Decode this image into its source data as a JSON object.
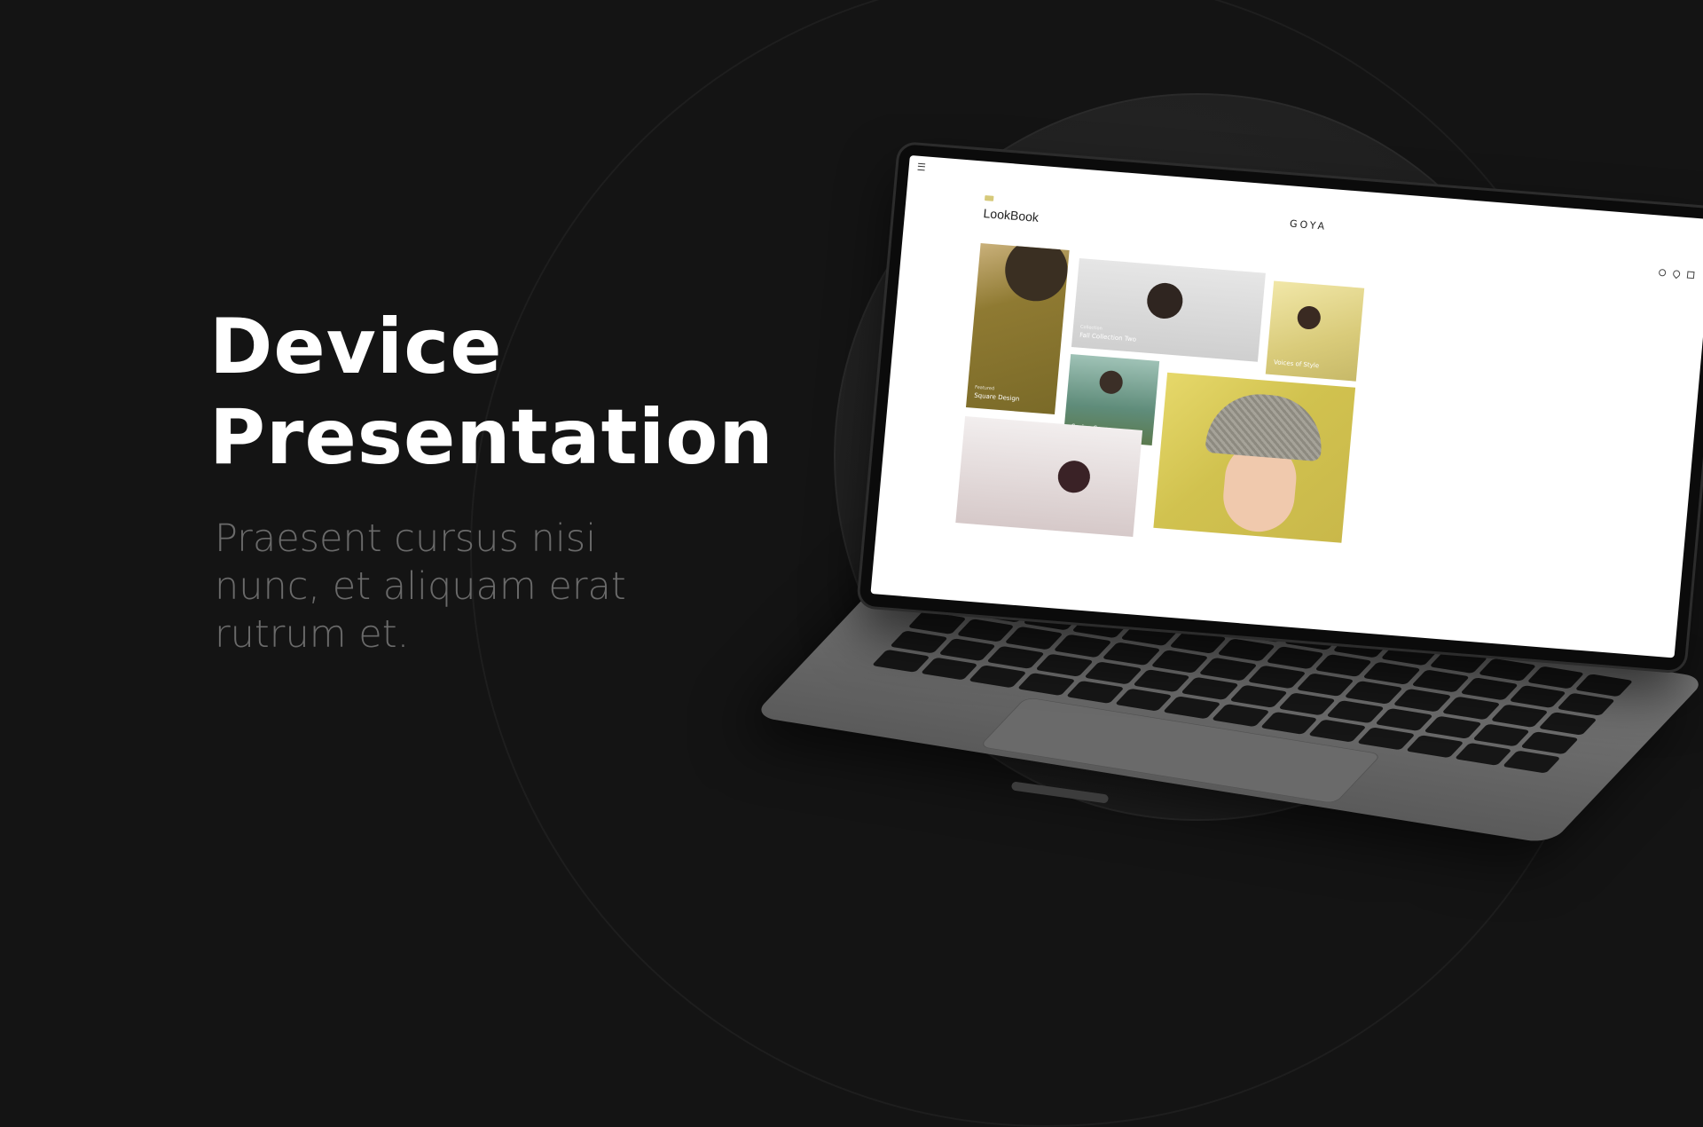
{
  "headline": {
    "line1": "Device",
    "line2": "Presentation"
  },
  "subtext": {
    "line1": "Praesent cursus nisi",
    "line2": "nunc, et aliquam erat",
    "line3": "rutrum et."
  },
  "mock_site": {
    "brand": "GOYA",
    "page_title": "LookBook",
    "tiles": [
      {
        "title": "Square Design",
        "tag": "Featured"
      },
      {
        "title": "Fall Collection Two",
        "tag": "Collection"
      },
      {
        "title": "Voices of Style",
        "tag": ""
      },
      {
        "title": "Spring Season",
        "tag": ""
      }
    ]
  },
  "colors": {
    "background": "#141414",
    "headline": "#ffffff",
    "subtext": "#6a6a6a",
    "laptop_body": "#6b6b6b",
    "screen": "#ffffff"
  },
  "icons": [
    "menu-icon",
    "search-icon",
    "heart-icon",
    "bag-icon"
  ]
}
